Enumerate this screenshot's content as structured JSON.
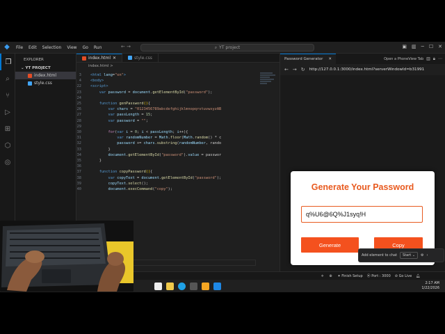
{
  "titlebar": {
    "menu": [
      "File",
      "Edit",
      "Selection",
      "View",
      "Go",
      "Run"
    ],
    "search": "YT project"
  },
  "explorer": {
    "header": "EXPLORER",
    "project": "YT PROJECT",
    "files": [
      "index.html",
      "style.css"
    ]
  },
  "editor": {
    "tabs": [
      "index.html",
      "style.css"
    ],
    "breadcrumb": "index.html >",
    "lines": [
      {
        "n": "3",
        "html": "<span class='t'>&lt;html</span> <span class='v'>lang</span>=<span class='s'>\"en\"</span><span class='t'>&gt;</span>"
      },
      {
        "n": "4",
        "html": "<span class='t'>&lt;body&gt;</span>"
      },
      {
        "n": "",
        "html": ""
      },
      {
        "n": "",
        "html": ""
      },
      {
        "n": "22",
        "html": "<span class='t'>&lt;script&gt;</span>"
      },
      {
        "n": "23",
        "html": "    <span class='k'>var</span> <span class='v'>password</span> = <span class='v'>document</span>.<span class='f'>getElementById</span>(<span class='s'>\"password\"</span>);"
      },
      {
        "n": "24",
        "html": ""
      },
      {
        "n": "25",
        "html": "    <span class='k'>function</span> <span class='f'>genPassword</span><span class='p'>()</span>{"
      },
      {
        "n": "26",
        "html": "        <span class='k'>var</span> <span class='v'>chars</span> = <span class='s'>\"0123456789abcdefghijklmnopqrstuvwxyzAB</span>"
      },
      {
        "n": "27",
        "html": "        <span class='k'>var</span> <span class='v'>passLength</span> = <span class='n'>15</span>;"
      },
      {
        "n": "28",
        "html": "        <span class='k'>var</span> <span class='v'>password</span> = <span class='s'>\"\"</span>;"
      },
      {
        "n": "29",
        "html": ""
      },
      {
        "n": "30",
        "html": "        <span class='c'>for</span>(<span class='k'>var</span> <span class='v'>i</span> = <span class='n'>0</span>; <span class='v'>i</span> &lt; <span class='v'>passLength</span>; <span class='v'>i</span>++){"
      },
      {
        "n": "31",
        "html": "            <span class='k'>var</span> <span class='v'>randomNumber</span> = <span class='v'>Math</span>.<span class='f'>floor</span>(<span class='v'>Math</span>.<span class='f'>random</span>() * c"
      },
      {
        "n": "32",
        "html": "            <span class='v'>password</span> += <span class='v'>chars</span>.<span class='f'>substring</span>(<span class='v'>randomNumber</span>, rando"
      },
      {
        "n": "33",
        "html": "        }"
      },
      {
        "n": "34",
        "html": "        <span class='v'>document</span>.<span class='f'>getElementById</span>(<span class='s'>\"password\"</span>).<span class='v'>value</span> = passwor"
      },
      {
        "n": "35",
        "html": "    }"
      },
      {
        "n": "36",
        "html": ""
      },
      {
        "n": "37",
        "html": "    <span class='k'>function</span> <span class='f'>copyPassword</span><span class='p'>()</span>{"
      },
      {
        "n": "38",
        "html": "        <span class='k'>var</span> <span class='v'>copyText</span> = <span class='v'>document</span>.<span class='f'>getElementById</span>(<span class='s'>\"password\"</span>);"
      },
      {
        "n": "39",
        "html": "        <span class='v'>copyText</span>.<span class='f'>select</span>();"
      },
      {
        "n": "40",
        "html": "        <span class='v'>document</span>.<span class='f'>execCommand</span>(<span class='s'>\"copy\"</span>);"
      }
    ]
  },
  "browser": {
    "tab": "Password Generator",
    "open_link": "Open a PhoneView Tab",
    "url": "http://127.0.0.1:3000/index.html?serverWindowId=b31991"
  },
  "app": {
    "title": "Generate Your Password",
    "password": "q%U6@6Q%J1syq!H",
    "generate": "Generate",
    "copy": "Copy",
    "accent": "#f4511e"
  },
  "chat": {
    "label": "Add element to chat",
    "start": "Start"
  },
  "status": {
    "finish": "Finish Setup",
    "port": "Port : 3000",
    "golive": "Go Live"
  },
  "clock": {
    "time": "2:17 AM",
    "date": "1/22/2026"
  }
}
